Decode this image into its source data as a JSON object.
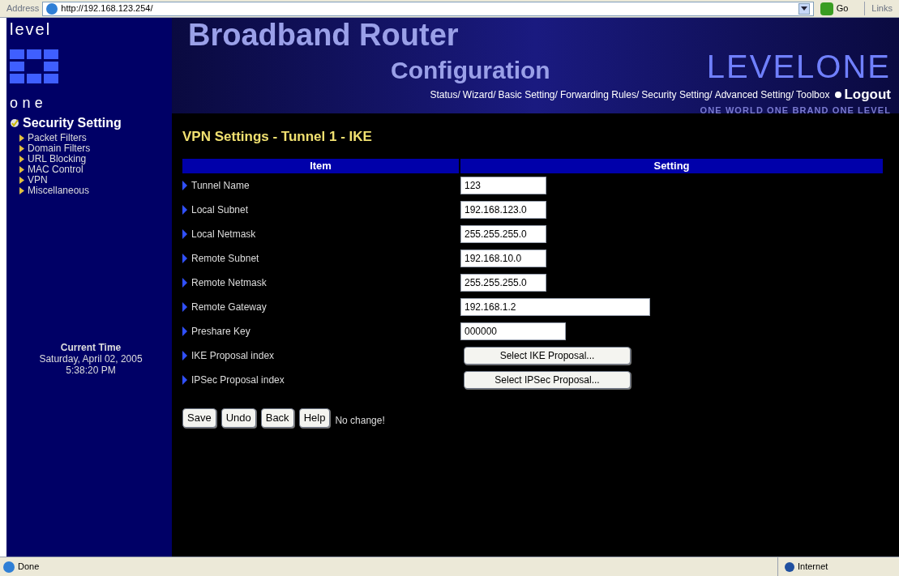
{
  "address_bar": {
    "label": "Address",
    "url": "http://192.168.123.254/",
    "go": "Go",
    "links": "Links"
  },
  "header": {
    "logo_top": "level",
    "logo_bottom": "one",
    "title": "Broadband Router",
    "subtitle": "Configuration",
    "brand": "LEVELONE",
    "slogan": "ONE WORLD ONE BRAND ONE LEVEL",
    "nav": [
      "Status/",
      "Wizard/",
      "Basic Setting/",
      "Forwarding Rules/",
      "Security Setting/",
      "Advanced Setting/",
      "Toolbox"
    ],
    "logout": "Logout"
  },
  "sidebar": {
    "section": "Security Setting",
    "items": [
      {
        "label": "Packet Filters"
      },
      {
        "label": "Domain Filters"
      },
      {
        "label": "URL Blocking"
      },
      {
        "label": "MAC Control"
      },
      {
        "label": "VPN"
      },
      {
        "label": "Miscellaneous"
      }
    ],
    "time_label": "Current Time",
    "date": "Saturday, April 02, 2005",
    "time": "5:38:20 PM"
  },
  "page_title": "VPN Settings - Tunnel 1 - IKE",
  "table": {
    "columns": [
      "Item",
      "Setting"
    ],
    "rows": [
      {
        "label": "Tunnel Name",
        "kind": "field",
        "value": "123"
      },
      {
        "label": "Local Subnet",
        "kind": "field",
        "value": "192.168.123.0"
      },
      {
        "label": "Local Netmask",
        "kind": "field",
        "value": "255.255.255.0"
      },
      {
        "label": "Remote Subnet",
        "kind": "field",
        "value": "192.168.10.0"
      },
      {
        "label": "Remote Netmask",
        "kind": "field",
        "value": "255.255.255.0"
      },
      {
        "label": "Remote Gateway",
        "kind": "field",
        "value": "192.168.1.2"
      },
      {
        "label": "Preshare Key",
        "kind": "field",
        "value": "000000"
      },
      {
        "label": "IKE Proposal index",
        "kind": "button",
        "value": "Select IKE Proposal..."
      },
      {
        "label": "IPSec Proposal index",
        "kind": "button",
        "value": "Select IPSec Proposal..."
      }
    ]
  },
  "buttons": [
    "Save",
    "Undo",
    "Back",
    "Help"
  ],
  "message": "No change!",
  "status_bar": {
    "status": "Done",
    "zone": "Internet"
  }
}
